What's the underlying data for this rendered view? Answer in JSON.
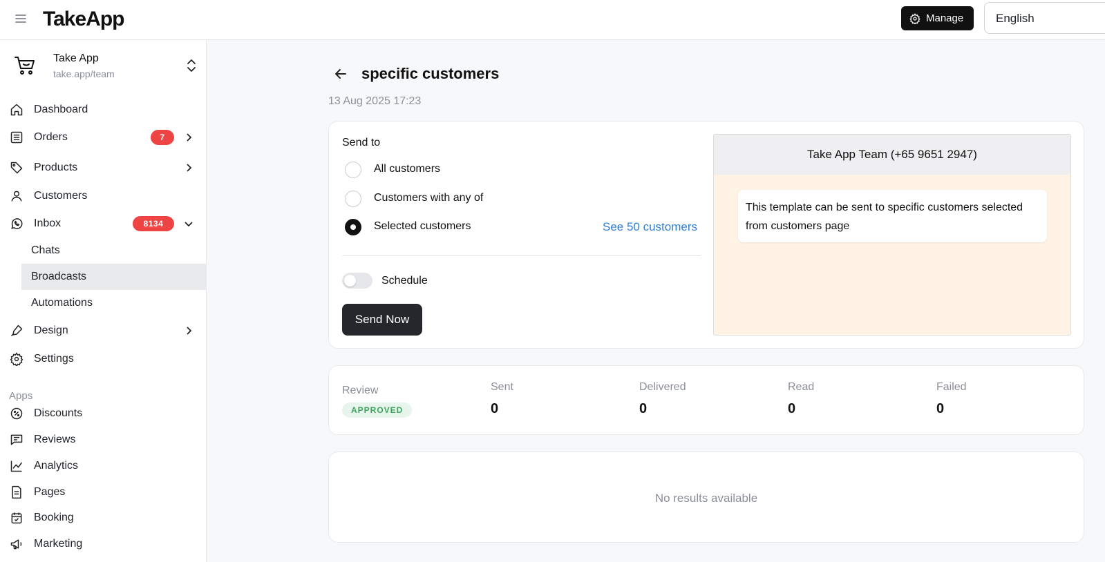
{
  "app": {
    "logo": "TakeApp",
    "manage_label": "Manage",
    "language": "English"
  },
  "store": {
    "name": "Take App",
    "url": "take.app/team"
  },
  "sidebar": {
    "items": [
      {
        "label": "Dashboard",
        "icon": "home-icon"
      },
      {
        "label": "Orders",
        "icon": "orders-list-icon",
        "badge": "7"
      },
      {
        "label": "Products",
        "icon": "tag-icon"
      },
      {
        "label": "Customers",
        "icon": "user-icon"
      },
      {
        "label": "Inbox",
        "icon": "whatsapp-icon",
        "badge": "8134"
      },
      {
        "label": "Design",
        "icon": "pen-icon"
      },
      {
        "label": "Settings",
        "icon": "gear-icon"
      }
    ],
    "inbox_sub": [
      "Chats",
      "Broadcasts",
      "Automations"
    ],
    "apps_label": "Apps",
    "apps": [
      {
        "label": "Discounts",
        "icon": "discount-icon"
      },
      {
        "label": "Reviews",
        "icon": "reviews-icon"
      },
      {
        "label": "Analytics",
        "icon": "analytics-icon"
      },
      {
        "label": "Pages",
        "icon": "page-icon"
      },
      {
        "label": "Booking",
        "icon": "calendar-icon"
      },
      {
        "label": "Marketing",
        "icon": "megaphone-icon"
      }
    ]
  },
  "page": {
    "title": "specific customers",
    "timestamp": "13 Aug 2025 17:23"
  },
  "send": {
    "label": "Send to",
    "options": [
      "All customers",
      "Customers with any of",
      "Selected customers"
    ],
    "selected_index": 2,
    "see_link": "See 50 customers",
    "schedule_label": "Schedule",
    "schedule_on": false,
    "send_button": "Send Now"
  },
  "preview": {
    "header": "Take App Team (+65 9651 2947)",
    "message": "This template can be sent to specific customers selected from customers page"
  },
  "stats": {
    "review_label": "Review",
    "review_status": "APPROVED",
    "items": [
      {
        "label": "Sent",
        "value": "0"
      },
      {
        "label": "Delivered",
        "value": "0"
      },
      {
        "label": "Read",
        "value": "0"
      },
      {
        "label": "Failed",
        "value": "0"
      }
    ]
  },
  "results": {
    "empty_text": "No results available"
  },
  "colors": {
    "accent_link": "#2f80d1",
    "badge_red": "#ef4444",
    "approved_green": "#3aa55d",
    "preview_bg": "#fff3e6"
  }
}
